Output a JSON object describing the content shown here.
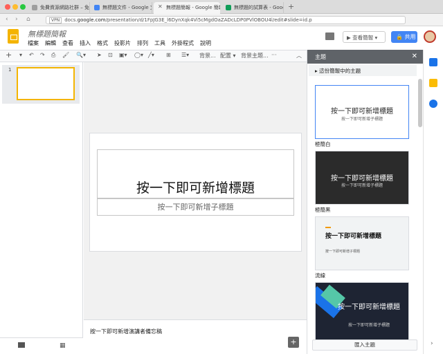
{
  "browser": {
    "tabs": [
      {
        "label": "免費資源網路社群 – 免費資源",
        "color": "#9e9e9e"
      },
      {
        "label": "無標題文件 - Google 文件",
        "color": "#4285f4"
      },
      {
        "label": "無標題簡報 - Google 簡報",
        "color": "#f4b400",
        "active": true
      },
      {
        "label": "無標題的試算表 - Google 試算",
        "color": "#0f9d58"
      }
    ],
    "url_prefix": "docs.",
    "url_domain": "google.com",
    "url_path": "/presentation/d/1FpJG3E_l6DynXqk4Vi5cMgdOaZADcLDP0PVlOBOU4l/edit#slide=id.p",
    "vpn": "VPN"
  },
  "app": {
    "doc_title": "無標題簡報",
    "menu": [
      "檔案",
      "編輯",
      "查看",
      "插入",
      "格式",
      "投影片",
      "排列",
      "工具",
      "外掛程式",
      "說明"
    ],
    "present_label": "查看簡報",
    "share_label": "共用"
  },
  "toolbar": {
    "background_label": "背景...",
    "layout_label": "配置",
    "theme_label": "背景主題...",
    "more": "···"
  },
  "filmstrip": {
    "slide_number": "1"
  },
  "slide": {
    "title": "按一下即可新增標題",
    "subtitle": "按一下即可新增子標題"
  },
  "notes": {
    "placeholder": "按一下即可新增演講者備忘稿"
  },
  "panel": {
    "header": "主題",
    "section": "這份簡報中的主題",
    "themes": [
      {
        "name": "極簡白",
        "title": "按一下即可新增標題",
        "subtitle": "按一下即可新增子標題"
      },
      {
        "name": "極簡黑",
        "title": "按一下即可新增標題",
        "subtitle": "按一下即可新增子標題"
      },
      {
        "name": "流線",
        "title": "按一下即可新增標題",
        "subtitle": "按一下即可新增子標題"
      },
      {
        "name": "",
        "title": "按一下即可新增標題",
        "subtitle": "按一下即可新增子標題"
      }
    ],
    "import_label": "匯入主題"
  }
}
